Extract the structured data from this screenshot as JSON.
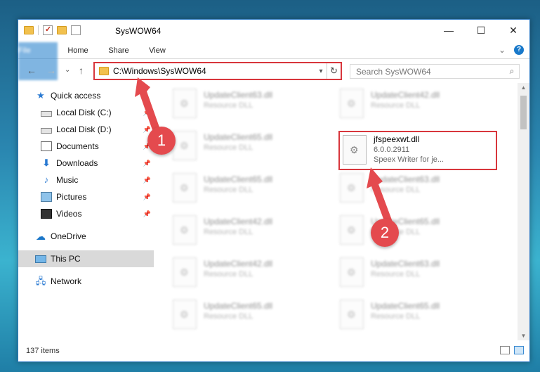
{
  "window": {
    "title": "SysWOW64",
    "controls": {
      "minimize": "—",
      "maximize": "☐",
      "close": "✕"
    }
  },
  "ribbon": {
    "tabs": [
      "File",
      "Home",
      "Share",
      "View"
    ],
    "expand": "⌄",
    "help": "?"
  },
  "nav": {
    "back": "←",
    "forward": "→",
    "recent": "⌄",
    "up": "↑",
    "address": "C:\\Windows\\SysWOW64",
    "refresh": "↻",
    "search_placeholder": "Search SysWOW64",
    "search_icon": "⌕"
  },
  "sidebar": {
    "items": [
      {
        "label": "Quick access",
        "icon": "star-icon"
      },
      {
        "label": "Local Disk (C:)",
        "icon": "drive-icon",
        "pinned": true
      },
      {
        "label": "Local Disk (D:)",
        "icon": "drive-icon",
        "pinned": true
      },
      {
        "label": "Documents",
        "icon": "documents-icon",
        "pinned": true
      },
      {
        "label": "Downloads",
        "icon": "downloads-icon",
        "pinned": true
      },
      {
        "label": "Music",
        "icon": "music-icon",
        "pinned": true
      },
      {
        "label": "Pictures",
        "icon": "pictures-icon",
        "pinned": true
      },
      {
        "label": "Videos",
        "icon": "videos-icon",
        "pinned": true
      },
      {
        "label": "OneDrive",
        "icon": "cloud-icon"
      },
      {
        "label": "This PC",
        "icon": "pc-icon",
        "selected": true
      },
      {
        "label": "Network",
        "icon": "network-icon"
      }
    ]
  },
  "files": [
    {
      "name": "UpdateClient63.dll",
      "type": "Resource DLL"
    },
    {
      "name": "UpdateClient42.dll",
      "type": "Resource DLL"
    },
    {
      "name": "UpdateClient65.dll",
      "type": "Resource DLL"
    },
    {
      "name": "UpdateClient65.dll",
      "type": "Resource DLL"
    },
    {
      "name": "UpdateClient63.dll",
      "type": "Resource DLL"
    },
    {
      "name": "UpdateClient42.dll",
      "type": "Resource DLL"
    },
    {
      "name": "UpdateClient65.dll",
      "type": "Resource DLL"
    },
    {
      "name": "UpdateClient42.dll",
      "type": "Resource DLL"
    },
    {
      "name": "UpdateClient63.dll",
      "type": "Resource DLL"
    },
    {
      "name": "UpdateClient65.dll",
      "type": "Resource DLL"
    },
    {
      "name": "UpdateClient65.dll",
      "type": "Resource DLL"
    }
  ],
  "target_file": {
    "name": "jfspeexwt.dll",
    "version": "6.0.0.2911",
    "description": "Speex Writer for je..."
  },
  "status": {
    "count": "137 items"
  },
  "annotations": {
    "step1": "1",
    "step2": "2",
    "color": "#e44a4e"
  }
}
